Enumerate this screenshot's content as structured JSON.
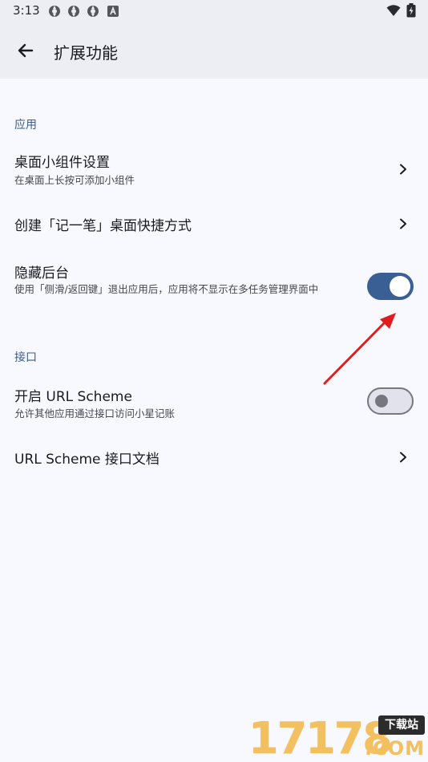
{
  "status_bar": {
    "time": "3:13",
    "notification_icons": [
      "sync-icon",
      "sync-icon",
      "sync-icon",
      "app-a-icon"
    ],
    "right_icons": [
      "wifi-icon",
      "battery-charging-icon"
    ]
  },
  "app_bar": {
    "back_icon": "arrow-left-icon",
    "title": "扩展功能"
  },
  "sections": {
    "apps": {
      "header": "应用",
      "widget": {
        "title": "桌面小组件设置",
        "subtitle": "在桌面上长按可添加小组件"
      },
      "shortcut": {
        "title": "创建「记一笔」桌面快捷方式"
      },
      "hide_background": {
        "title": "隐藏后台",
        "subtitle": "使用「侧滑/返回键」退出应用后，应用将不显示在多任务管理界面中",
        "enabled": true
      }
    },
    "interface": {
      "header": "接口",
      "url_scheme": {
        "title": "开启 URL Scheme",
        "subtitle": "允许其他应用通过接口访问小星记账",
        "enabled": false
      },
      "url_docs": {
        "title": "URL Scheme 接口文档"
      }
    }
  },
  "watermark": {
    "number": "17178",
    "tag": "下载站",
    "suffix": ".COM"
  },
  "colors": {
    "accent": "#3a5f95",
    "section_header": "#3d5a8a",
    "app_bar_bg": "#eceef4",
    "background": "#f8f9ff",
    "annotation_arrow": "#e01e1e"
  }
}
